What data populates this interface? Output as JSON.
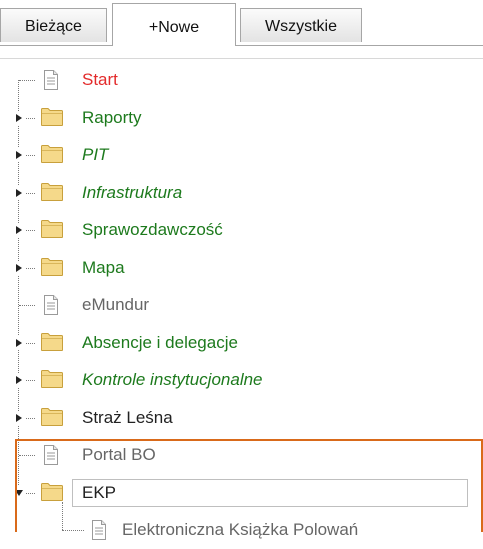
{
  "tabs": [
    {
      "label": "Bieżące",
      "active": false
    },
    {
      "label": "+Nowe",
      "active": true
    },
    {
      "label": "Wszystkie",
      "active": false
    }
  ],
  "tree": {
    "items": [
      {
        "label": "Start",
        "type": "document",
        "color": "#e32b2b"
      },
      {
        "label": "Raporty",
        "type": "folder",
        "state": "collapsed",
        "color": "#1d7a1d"
      },
      {
        "label": "PIT",
        "type": "folder",
        "state": "collapsed",
        "color": "#1d7a1d",
        "italic": true
      },
      {
        "label": "Infrastruktura",
        "type": "folder",
        "state": "collapsed",
        "color": "#1d7a1d",
        "italic": true
      },
      {
        "label": "Sprawozdawczość",
        "type": "folder",
        "state": "collapsed",
        "color": "#1d7a1d"
      },
      {
        "label": "Mapa",
        "type": "folder",
        "state": "collapsed",
        "color": "#1d7a1d"
      },
      {
        "label": "eMundur",
        "type": "document",
        "color": "#666666"
      },
      {
        "label": "Absencje i delegacje",
        "type": "folder",
        "state": "collapsed",
        "color": "#1d7a1d"
      },
      {
        "label": "Kontrole instytucjonalne",
        "type": "folder",
        "state": "collapsed",
        "color": "#1d7a1d",
        "italic": true
      },
      {
        "label": "Straż Leśna",
        "type": "folder",
        "state": "collapsed",
        "color": "#222222"
      },
      {
        "label": "Portal BO",
        "type": "document",
        "color": "#666666"
      },
      {
        "label": "EKP",
        "type": "folder",
        "state": "expanded",
        "color": "#222222",
        "selected": true
      },
      {
        "label": "Elektroniczna Książka Polowań",
        "type": "document",
        "color": "#666666",
        "child_of": "EKP"
      }
    ]
  },
  "colors": {
    "folder_fill": "#f5d98a",
    "folder_stroke": "#c8a03c",
    "highlight_frame": "#d96a1a"
  },
  "icons": {
    "document": "document-icon",
    "folder": "folder-icon",
    "expander_collapsed": "triangle-right-icon",
    "expander_expanded": "triangle-down-icon"
  }
}
